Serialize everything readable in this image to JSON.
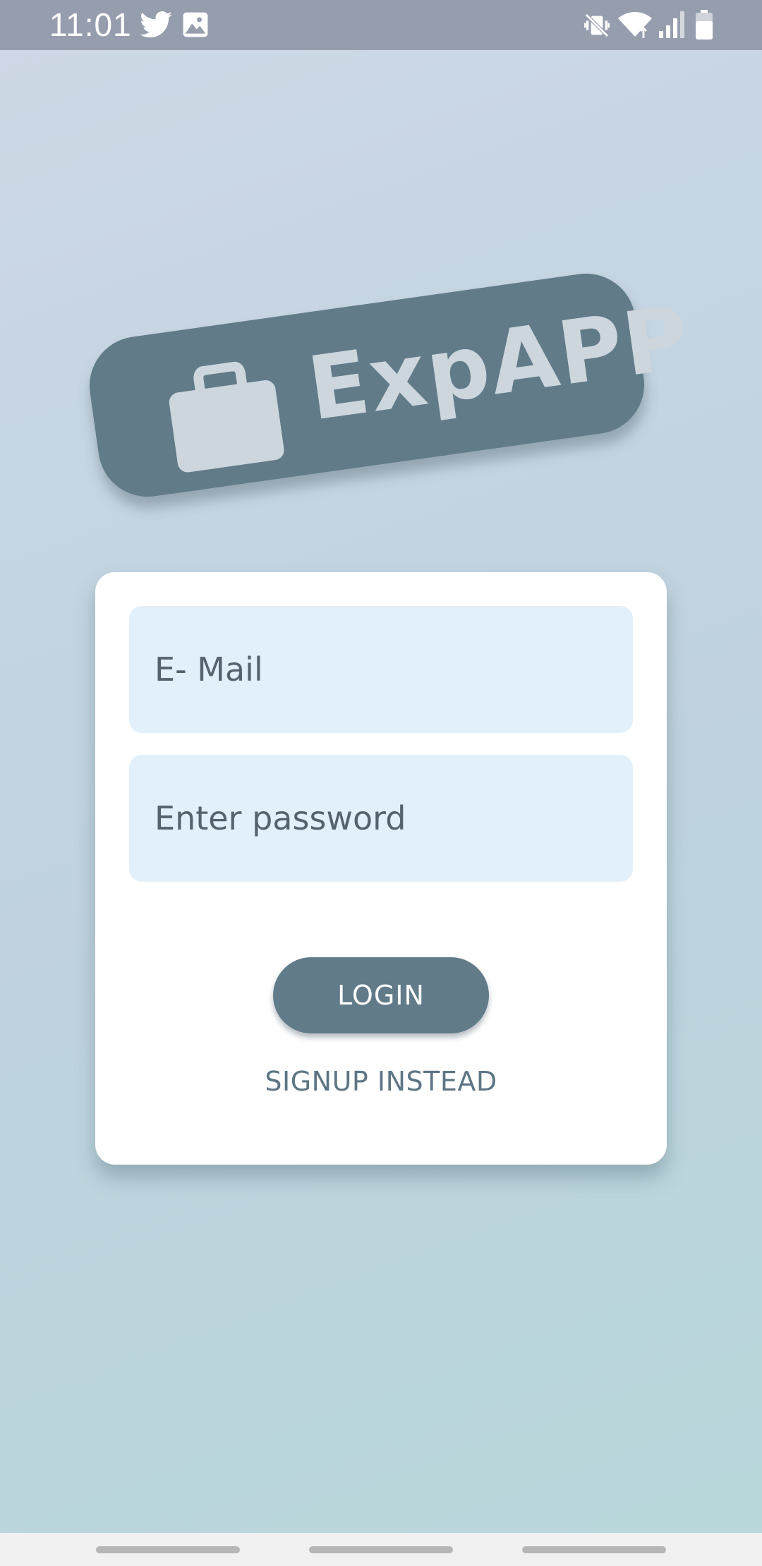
{
  "status_bar": {
    "time": "11:01",
    "left_icons": [
      "twitter-icon",
      "image-icon"
    ],
    "right_icons": [
      "mute-vibrate-icon",
      "wifi-icon",
      "signal-icon",
      "battery-icon"
    ]
  },
  "logo": {
    "text": "ExpAPP",
    "icon": "briefcase-icon",
    "banner_color": "#617b89",
    "foreground_color": "#cdd6dd"
  },
  "login_form": {
    "email": {
      "placeholder": "E- Mail",
      "value": ""
    },
    "password": {
      "placeholder": "Enter password",
      "value": ""
    },
    "login_label": "LOGIN",
    "signup_label": "SIGNUP INSTEAD"
  },
  "nav_bar": {
    "items": [
      "recents-button",
      "home-button",
      "back-button"
    ]
  },
  "colors": {
    "accent": "#617b89",
    "field_bg": "#e2f0fb",
    "card_bg": "#ffffff",
    "status_bar_bg": "#969eae"
  }
}
